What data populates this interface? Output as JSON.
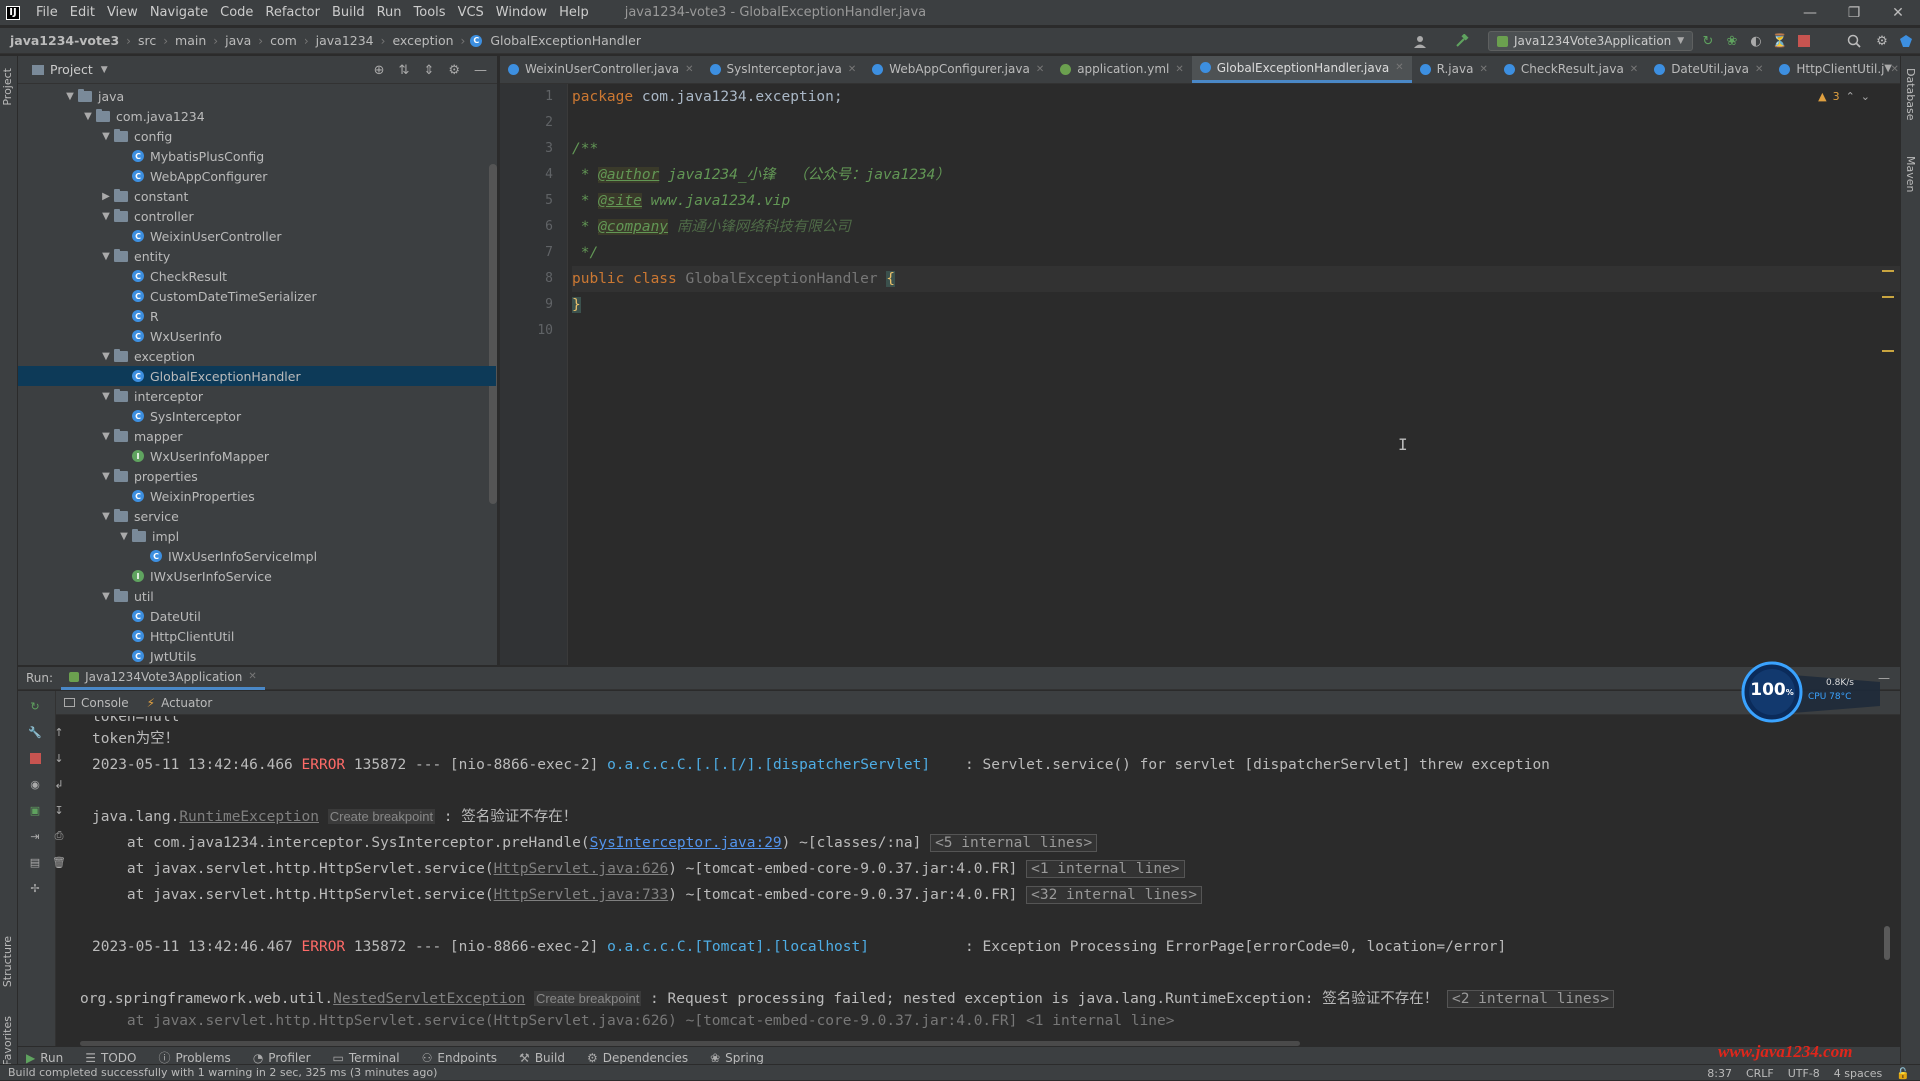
{
  "window": {
    "title": "java1234-vote3 - GlobalExceptionHandler.java",
    "menu": [
      "File",
      "Edit",
      "View",
      "Navigate",
      "Code",
      "Refactor",
      "Build",
      "Run",
      "Tools",
      "VCS",
      "Window",
      "Help"
    ]
  },
  "breadcrumb": [
    "java1234-vote3",
    "src",
    "main",
    "java",
    "com",
    "java1234",
    "exception",
    "GlobalExceptionHandler"
  ],
  "run_config": "Java1234Vote3Application",
  "project": {
    "title": "Project",
    "tree": [
      {
        "label": "java",
        "depth": 0,
        "type": "folder",
        "open": true
      },
      {
        "label": "com.java1234",
        "depth": 1,
        "type": "folder",
        "open": true
      },
      {
        "label": "config",
        "depth": 2,
        "type": "folder",
        "open": true
      },
      {
        "label": "MybatisPlusConfig",
        "depth": 3,
        "type": "class"
      },
      {
        "label": "WebAppConfigurer",
        "depth": 3,
        "type": "class"
      },
      {
        "label": "constant",
        "depth": 2,
        "type": "folder",
        "open": false
      },
      {
        "label": "controller",
        "depth": 2,
        "type": "folder",
        "open": true
      },
      {
        "label": "WeixinUserController",
        "depth": 3,
        "type": "class"
      },
      {
        "label": "entity",
        "depth": 2,
        "type": "folder",
        "open": true
      },
      {
        "label": "CheckResult",
        "depth": 3,
        "type": "class"
      },
      {
        "label": "CustomDateTimeSerializer",
        "depth": 3,
        "type": "class"
      },
      {
        "label": "R",
        "depth": 3,
        "type": "class"
      },
      {
        "label": "WxUserInfo",
        "depth": 3,
        "type": "class"
      },
      {
        "label": "exception",
        "depth": 2,
        "type": "folder",
        "open": true
      },
      {
        "label": "GlobalExceptionHandler",
        "depth": 3,
        "type": "class",
        "selected": true
      },
      {
        "label": "interceptor",
        "depth": 2,
        "type": "folder",
        "open": true
      },
      {
        "label": "SysInterceptor",
        "depth": 3,
        "type": "class"
      },
      {
        "label": "mapper",
        "depth": 2,
        "type": "folder",
        "open": true
      },
      {
        "label": "WxUserInfoMapper",
        "depth": 3,
        "type": "interface"
      },
      {
        "label": "properties",
        "depth": 2,
        "type": "folder",
        "open": true
      },
      {
        "label": "WeixinProperties",
        "depth": 3,
        "type": "class"
      },
      {
        "label": "service",
        "depth": 2,
        "type": "folder",
        "open": true
      },
      {
        "label": "impl",
        "depth": 3,
        "type": "folder",
        "open": true
      },
      {
        "label": "IWxUserInfoServiceImpl",
        "depth": 4,
        "type": "class"
      },
      {
        "label": "IWxUserInfoService",
        "depth": 3,
        "type": "interface"
      },
      {
        "label": "util",
        "depth": 2,
        "type": "folder",
        "open": true
      },
      {
        "label": "DateUtil",
        "depth": 3,
        "type": "class"
      },
      {
        "label": "HttpClientUtil",
        "depth": 3,
        "type": "class"
      },
      {
        "label": "JwtUtils",
        "depth": 3,
        "type": "class"
      }
    ]
  },
  "editor_tabs": [
    {
      "label": "WeixinUserController.java",
      "type": "class"
    },
    {
      "label": "SysInterceptor.java",
      "type": "class"
    },
    {
      "label": "WebAppConfigurer.java",
      "type": "class"
    },
    {
      "label": "application.yml",
      "type": "yml"
    },
    {
      "label": "GlobalExceptionHandler.java",
      "type": "class",
      "active": true
    },
    {
      "label": "R.java",
      "type": "class"
    },
    {
      "label": "CheckResult.java",
      "type": "class"
    },
    {
      "label": "DateUtil.java",
      "type": "class"
    },
    {
      "label": "HttpClientUtil.j",
      "type": "class"
    }
  ],
  "editor": {
    "warning_count": "3",
    "code": {
      "l1_kw": "package",
      "l1_rest": " com.java1234.exception;",
      "l3": "/**",
      "l4_pre": " * ",
      "l4_tag": "@author",
      "l4_rest": " java1234_小锋  （公众号：java1234）",
      "l5_pre": " * ",
      "l5_tag": "@site",
      "l5_rest": " www.java1234.vip",
      "l6_pre": " * ",
      "l6_tag": "@company",
      "l6_rest": " 南通小锋网络科技有限公司",
      "l7": " */",
      "l8_kw": "public class",
      "l8_cls": " GlobalExceptionHandler ",
      "l8_brace": "{",
      "l9": "}"
    },
    "line_numbers": [
      "1",
      "2",
      "3",
      "4",
      "5",
      "6",
      "7",
      "8",
      "9",
      "10"
    ]
  },
  "run_panel": {
    "label": "Run:",
    "tab": "Java1234Vote3Application",
    "subtabs": [
      "Console",
      "Actuator"
    ]
  },
  "console": {
    "l0": "token=null",
    "l1": "token为空！",
    "l2_ts": "2023-05-11 13:42:46.466 ",
    "l2_lvl": "ERROR",
    "l2_pid": " 135872 --- [nio-8866-exec-2] ",
    "l2_logger": "o.a.c.c.C.[.[.[/].[dispatcherServlet]",
    "l2_msg": "    : Servlet.service() for servlet [dispatcherServlet] threw exception",
    "l4_a": "java.lang.",
    "l4_b": "RuntimeException",
    "l4_hint": "Create breakpoint",
    "l4_c": " : 签名验证不存在！",
    "l5_a": "    at com.java1234.interceptor.SysInterceptor.preHandle(",
    "l5_link": "SysInterceptor.java:29",
    "l5_b": ") ~[classes/:na] ",
    "l5_box": "<5 internal lines>",
    "l6_a": "    at javax.servlet.http.HttpServlet.service(",
    "l6_link": "HttpServlet.java:626",
    "l6_b": ") ~[tomcat-embed-core-9.0.37.jar:4.0.FR] ",
    "l6_box": "<1 internal line>",
    "l7_a": "    at javax.servlet.http.HttpServlet.service(",
    "l7_link": "HttpServlet.java:733",
    "l7_b": ") ~[tomcat-embed-core-9.0.37.jar:4.0.FR] ",
    "l7_box": "<32 internal lines>",
    "l9_ts": "2023-05-11 13:42:46.467 ",
    "l9_lvl": "ERROR",
    "l9_pid": " 135872 --- [nio-8866-exec-2] ",
    "l9_logger": "o.a.c.c.C.[Tomcat].[localhost]",
    "l9_msg": "           : Exception Processing ErrorPage[errorCode=0, location=/error]",
    "l11_a": "org.springframework.web.util.",
    "l11_b": "NestedServletException",
    "l11_hint": "Create breakpoint",
    "l11_c": " : Request processing failed; nested exception is java.lang.RuntimeException: 签名验证不存在！ ",
    "l11_box": "<2 internal lines>",
    "l12": "    at javax.servlet.http.HttpServlet.service(HttpServlet.java:626) ~[tomcat-embed-core-9.0.37.jar:4.0.FR] <1 internal line>"
  },
  "bottom_tools": [
    "Run",
    "TODO",
    "Problems",
    "Profiler",
    "Terminal",
    "Endpoints",
    "Build",
    "Dependencies",
    "Spring"
  ],
  "status": {
    "message": "Build completed successfully with 1 warning in 2 sec, 325 ms (3 minutes ago)",
    "position": "8:37",
    "line_sep": "CRLF",
    "encoding": "UTF-8",
    "indent": "4 spaces"
  },
  "perf_widget": {
    "percent": "100",
    "unit": "%",
    "net": "0.8K/s",
    "cpu": "CPU 78°C"
  },
  "watermark": "www.java1234.com",
  "side_labels": {
    "project": "Project",
    "structure": "Structure",
    "favorites": "Favorites",
    "database": "Database",
    "maven": "Maven"
  },
  "colors": {
    "accent": "#4a88c7",
    "error": "#ff6b68",
    "keyword": "#cc7832",
    "comment": "#629755"
  }
}
